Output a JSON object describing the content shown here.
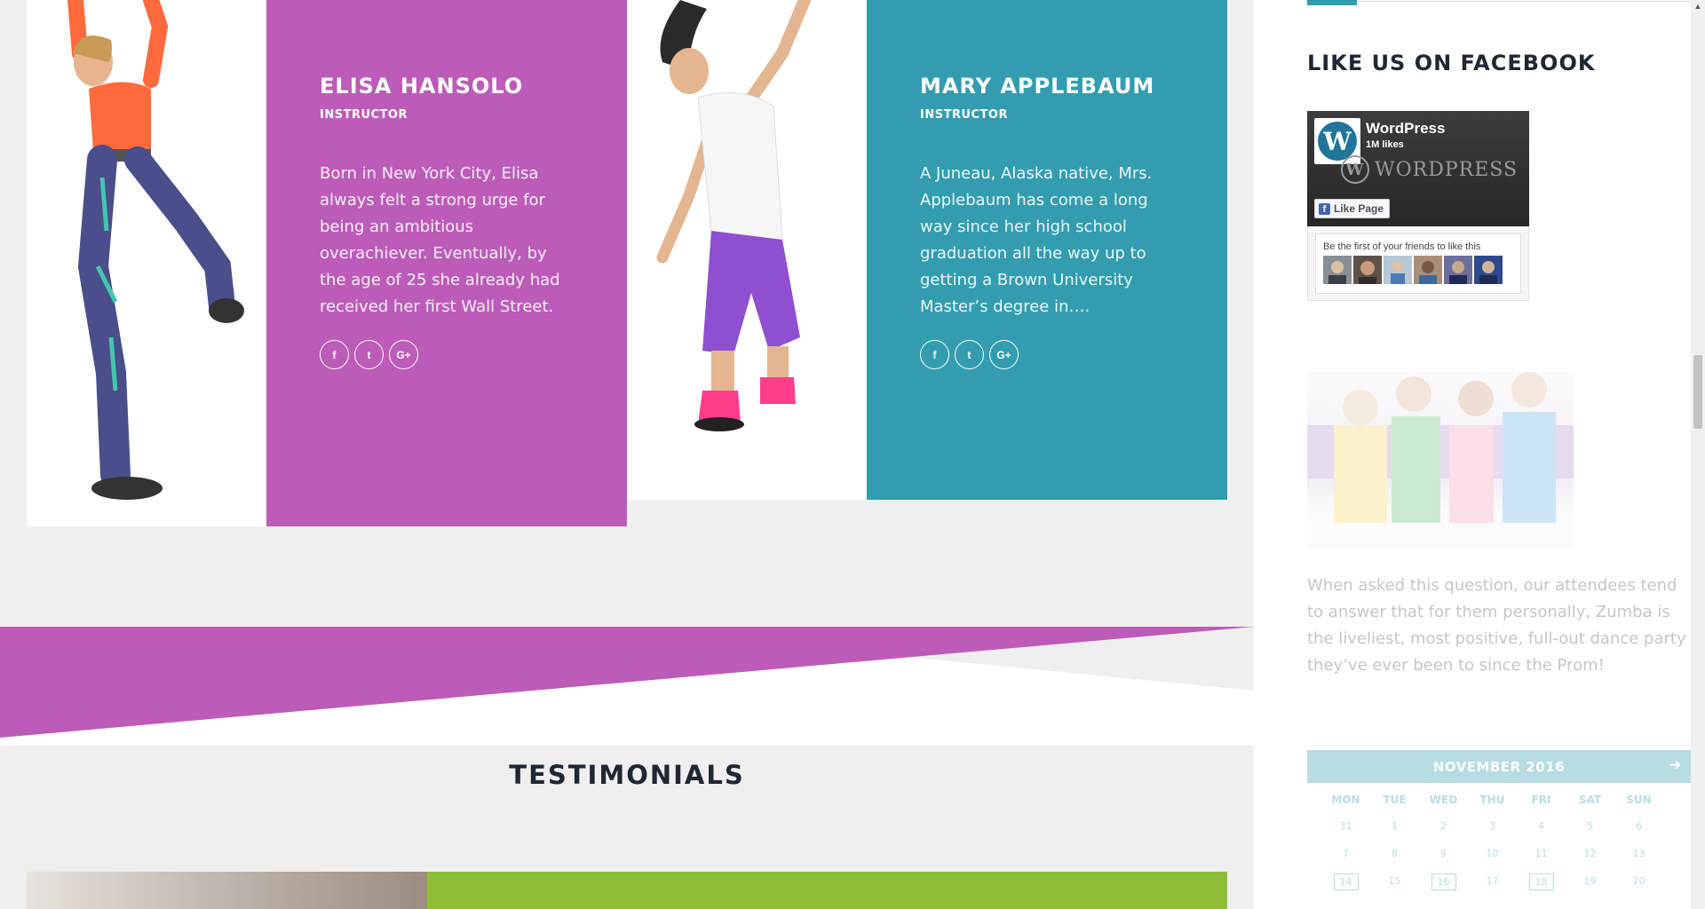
{
  "instructors": [
    {
      "name": "ELISA HANSOLO",
      "role": "INSTRUCTOR",
      "bio": "Born in New York City, Elisa always felt a strong urge for being an ambitious overachiever. Eventually, by the age of 25 she already had received her first Wall Street.",
      "social": [
        "f",
        "t",
        "G+"
      ],
      "color": "#bc5cb8"
    },
    {
      "name": "MARY APPLEBAUM",
      "role": "INSTRUCTOR",
      "bio": "A Juneau, Alaska native, Mrs. Applebaum has come a long way since her high school graduation all the way up to getting a Brown University Master’s degree in….",
      "social": [
        "f",
        "t",
        "G+"
      ],
      "color": "#339daf"
    }
  ],
  "testimonials": {
    "title": "TESTIMONIALS",
    "accent": "#8dbd35"
  },
  "sidebar": {
    "facebook_heading": "LIKE US ON FACEBOOK",
    "fb_page": {
      "name": "WordPress",
      "likes": "1M likes",
      "wordmark": "WORDPRESS",
      "like_button": "Like Page",
      "friends_text": "Be the first of your friends to like this"
    },
    "promo_text": "When asked this question, our attendees tend to answer that for them personally, Zumba is the liveliest, most positive, full-out dance party they’ve ever been to since the Prom!",
    "calendar": {
      "month": "NOVEMBER 2016",
      "next_icon": "arrow-right-icon",
      "days_of_week": [
        "MON",
        "TUE",
        "WED",
        "THU",
        "FRI",
        "SAT",
        "SUN"
      ],
      "rows": [
        [
          "31",
          "1",
          "2",
          "3",
          "4",
          "5",
          "6"
        ],
        [
          "7",
          "8",
          "9",
          "10",
          "11",
          "12",
          "13"
        ],
        [
          "14",
          "15",
          "16",
          "17",
          "18",
          "19",
          "20"
        ]
      ],
      "highlighted": [
        "14",
        "16",
        "18"
      ]
    }
  },
  "colors": {
    "purple": "#bc5cb8",
    "teal": "#339daf",
    "green": "#8dbd35",
    "heading": "#1f2733",
    "background": "#efefef"
  }
}
